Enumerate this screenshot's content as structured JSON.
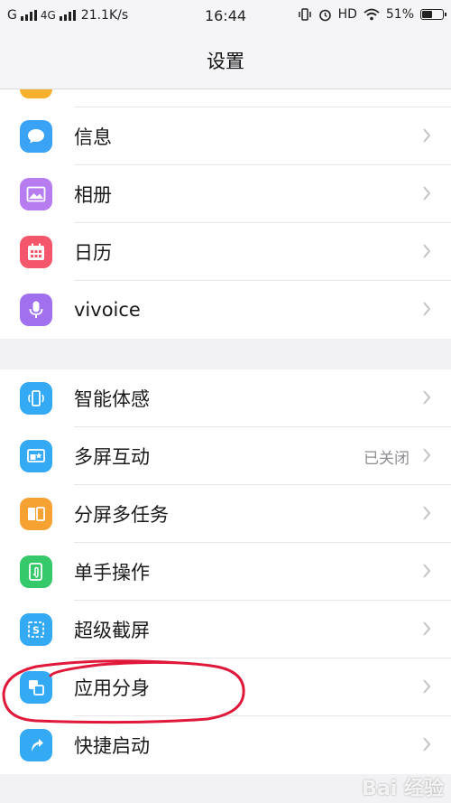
{
  "status_bar": {
    "carrier1": "G",
    "carrier2": "4G",
    "speed": "21.1K/s",
    "time": "16:44",
    "hd": "HD",
    "battery": "51%",
    "battery_level": 0.51
  },
  "header": {
    "title": "设置"
  },
  "group1": {
    "items": [
      {
        "label": "信息",
        "icon": "message-icon",
        "color": "#3aa3f5"
      },
      {
        "label": "相册",
        "icon": "photo-icon",
        "color": "#b67cf0"
      },
      {
        "label": "日历",
        "icon": "calendar-icon",
        "color": "#f4566b"
      },
      {
        "label": "vivoice",
        "icon": "microphone-icon",
        "color": "#a070ee"
      }
    ]
  },
  "group2": {
    "items": [
      {
        "label": "智能体感",
        "icon": "phone-motion-icon",
        "color": "#34aaf4"
      },
      {
        "label": "多屏互动",
        "value": "已关闭",
        "icon": "multiscreen-icon",
        "color": "#34aaf4"
      },
      {
        "label": "分屏多任务",
        "icon": "split-screen-icon",
        "color": "#f6a232"
      },
      {
        "label": "单手操作",
        "icon": "one-hand-icon",
        "color": "#35c96a"
      },
      {
        "label": "超级截屏",
        "icon": "screenshot-icon",
        "color": "#34aaf4"
      },
      {
        "label": "应用分身",
        "icon": "app-clone-icon",
        "color": "#34aaf4"
      },
      {
        "label": "快捷启动",
        "icon": "quick-launch-icon",
        "color": "#34aaf4"
      }
    ]
  },
  "watermark": "Bai 经验"
}
